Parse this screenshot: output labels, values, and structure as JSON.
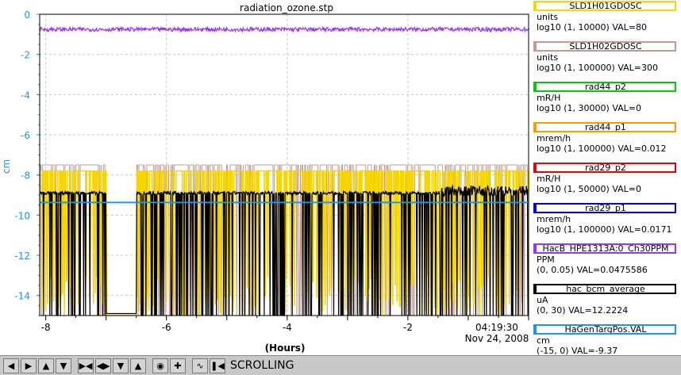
{
  "window_title": "radiation_ozone.stp",
  "chart_data": {
    "type": "line",
    "title": "radiation_ozone.stp",
    "ylabel": "cm",
    "xlabel": "(Hours)",
    "ylim": [
      -15,
      0
    ],
    "xlim": [
      -8.1,
      0
    ],
    "y_ticks": [
      0,
      -2,
      -4,
      -6,
      -8,
      -10,
      -12,
      -14
    ],
    "x_ticks": [
      -8,
      -6,
      -4,
      -2
    ],
    "end_time": "04:19:30",
    "end_date": "Nov 24, 2008",
    "grid": true,
    "series": [
      {
        "name": "SLD1H01GDOSC",
        "color": "#f7d600",
        "approx_level": -7.8
      },
      {
        "name": "SLD1H02GDOSC",
        "color": "#bf9c96",
        "approx_level": -7.5
      },
      {
        "name": "rad44_p2",
        "color": "#00cc00"
      },
      {
        "name": "rad44_p1",
        "color": "#ff9900"
      },
      {
        "name": "rad29_p2",
        "color": "#ee0000"
      },
      {
        "name": "rad29_p1",
        "color": "#0000ee"
      },
      {
        "name": "HacB_HPE1313A:0_Ch30PPM",
        "color": "#9933ff",
        "approx_level": -0.75
      },
      {
        "name": "hac_bcm_average",
        "color": "#000000",
        "approx_level": -8.9
      },
      {
        "name": "HaGenTargPos.VAL",
        "color": "#1e90ff",
        "value": -9.37
      }
    ],
    "gaps": [
      [
        -7.0,
        -6.5
      ]
    ]
  },
  "legend": [
    {
      "name": "SLD1H01GDOSC",
      "units": "units",
      "range": "log10 (1, 10000) VAL=80",
      "color": "#f7d600"
    },
    {
      "name": "SLD1H02GDOSC",
      "units": "units",
      "range": "log10 (1, 100000) VAL=300",
      "color": "#bf9c96"
    },
    {
      "name": "rad44_p2",
      "units": "mR/H",
      "range": "log10 (1, 30000) VAL=0",
      "color": "#00cc00"
    },
    {
      "name": "rad44_p1",
      "units": "mrem/h",
      "range": "log10 (1, 100000) VAL=0.012",
      "color": "#ff9900"
    },
    {
      "name": "rad29_p2",
      "units": "mR/H",
      "range": "log10 (1, 50000) VAL=0",
      "color": "#ee0000"
    },
    {
      "name": "rad29_p1",
      "units": "mrem/h",
      "range": "log10 (1, 100000) VAL=0.0171",
      "color": "#0000ee"
    },
    {
      "name": "HacB_HPE1313A:0_Ch30PPM",
      "units": "PPM",
      "range": "(0, 0.05) VAL=0.0475586",
      "color": "#9933ff"
    },
    {
      "name": "hac_bcm_average",
      "units": "uA",
      "range": "(0, 30) VAL=12.2224",
      "color": "#000000"
    },
    {
      "name": "HaGenTargPos.VAL",
      "units": "cm",
      "range": "(-15, 0) VAL=-9.37",
      "color": "#1e90ff"
    }
  ],
  "toolbar": {
    "buttons": [
      "arrow-left-icon",
      "arrow-right-icon",
      "arrow-up-icon",
      "arrow-down-icon",
      "zoom-in-x-icon",
      "zoom-out-x-icon",
      "zoom-in-y-icon",
      "zoom-out-y-icon",
      "config-icon",
      "add-icon",
      "autoscale-icon",
      "pause-icon"
    ],
    "status": "SCROLLING"
  }
}
